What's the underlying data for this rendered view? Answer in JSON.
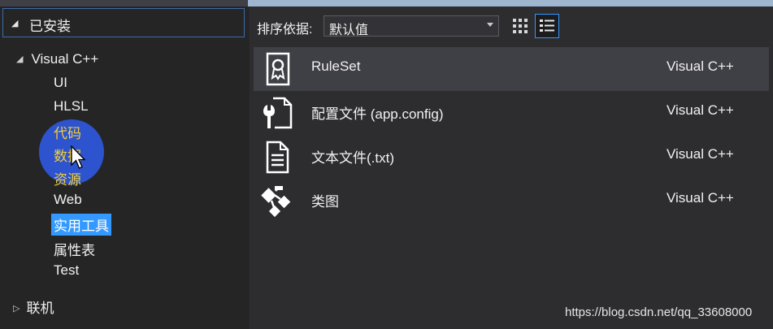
{
  "left_pane": {
    "installed_label": "已安装",
    "tree": {
      "root_label": "Visual C++",
      "children": [
        "UI",
        "HLSL",
        "代码",
        "数据",
        "资源",
        "Web",
        "实用工具",
        "属性表",
        "Test"
      ],
      "online_label": "联机"
    }
  },
  "right_pane": {
    "sort_label": "排序依据:",
    "sort_value": "默认值",
    "templates": [
      {
        "name": "RuleSet",
        "lang": "Visual C++",
        "icon": "ruleset-icon"
      },
      {
        "name": "配置文件 (app.config)",
        "lang": "Visual C++",
        "icon": "config-file-icon"
      },
      {
        "name": "文本文件(.txt)",
        "lang": "Visual C++",
        "icon": "text-file-icon"
      },
      {
        "name": "类图",
        "lang": "Visual C++",
        "icon": "class-diagram-icon"
      }
    ]
  },
  "watermark": "https://blog.csdn.net/qq_33608000",
  "colors": {
    "selection": "#3399ff",
    "highlight_text": "#f0ce3c",
    "cursor_circle": "#2f5ae6"
  }
}
